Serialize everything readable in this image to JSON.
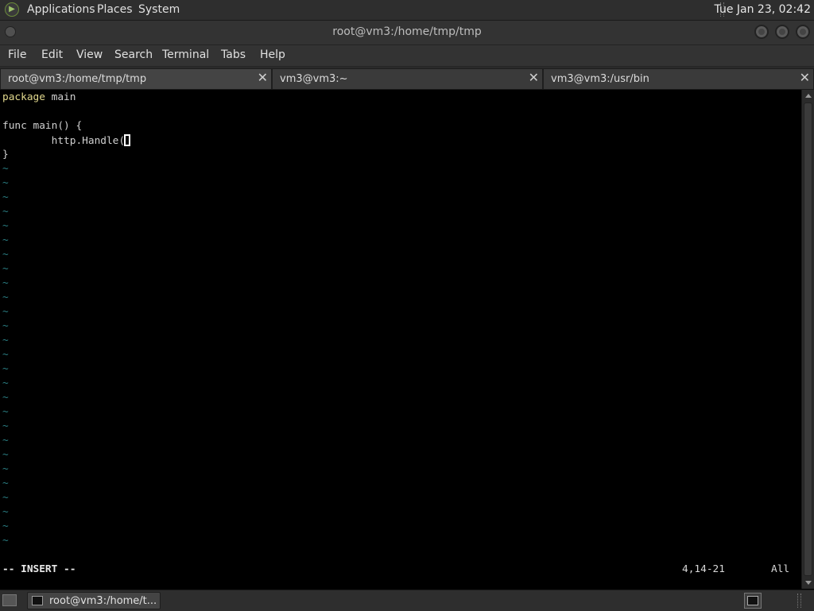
{
  "top_panel": {
    "menus": [
      "Applications",
      "Places",
      "System"
    ],
    "clock": "Tue Jan 23, 02:42"
  },
  "window": {
    "title": "root@vm3:/home/tmp/tmp"
  },
  "menubar": [
    "File",
    "Edit",
    "View",
    "Search",
    "Terminal",
    "Tabs",
    "Help"
  ],
  "tabs": [
    {
      "label": "root@vm3:/home/tmp/tmp",
      "active": true
    },
    {
      "label": "vm3@vm3:~",
      "active": false
    },
    {
      "label": "vm3@vm3:/usr/bin",
      "active": false
    }
  ],
  "editor": {
    "lines": {
      "l1_kw": "package",
      "l1_rest": " main",
      "l3": "func main() {",
      "l4": "        http.Handle(",
      "l5": "}"
    },
    "tilde": "~",
    "status_mode": "-- INSERT --",
    "status_position": "4,14-21",
    "status_scroll": "All"
  },
  "taskbar": {
    "task_label": "root@vm3:/home/t..."
  },
  "colors": {
    "keyword": "#e2d98e",
    "tilde": "#2a7d82",
    "panel": "#2e2e2e"
  }
}
